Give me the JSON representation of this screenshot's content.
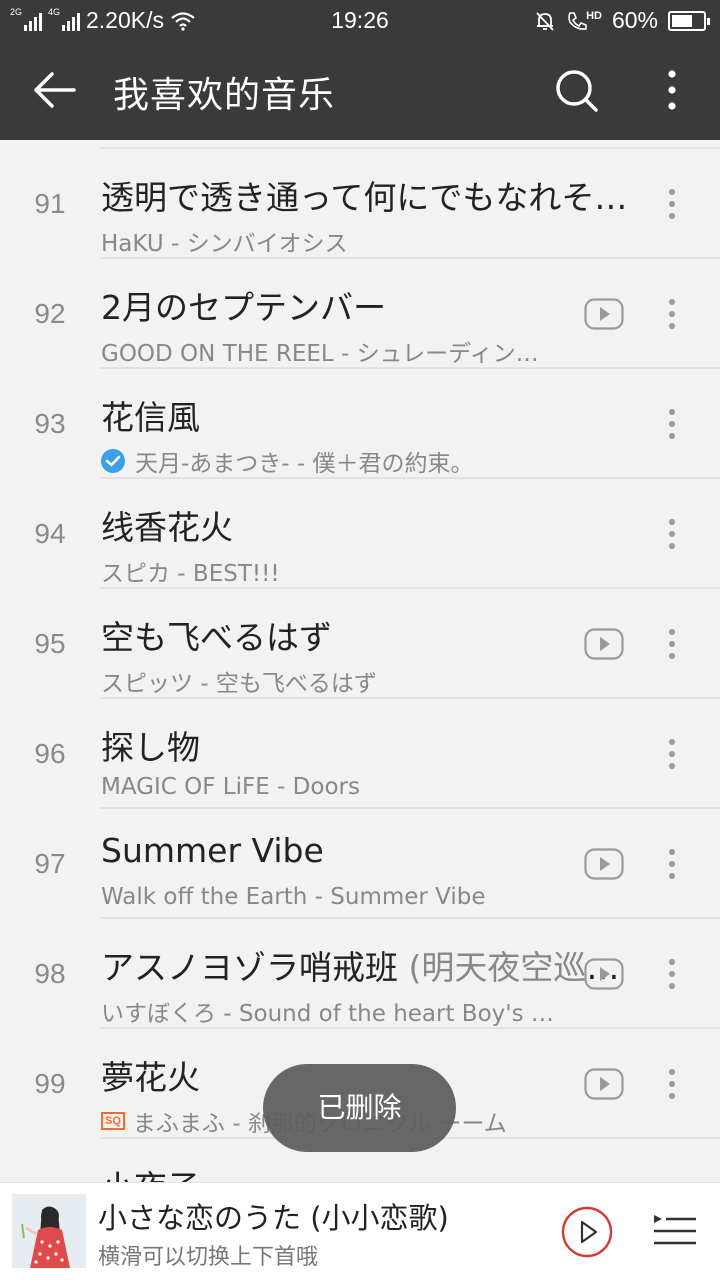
{
  "status_bar": {
    "sim1": "2G",
    "sim2": "4G",
    "speed": "2.20K/s",
    "time": "19:26",
    "battery": "60%",
    "hd_label": "HD"
  },
  "app_bar": {
    "title": "我喜欢的音乐"
  },
  "songs": [
    {
      "index": "91",
      "title": "透明で透き通って何にでもなれそうで",
      "alias": "",
      "subtitle": "HaKU - シンバイオシス",
      "has_mv": false,
      "badge": ""
    },
    {
      "index": "92",
      "title": "2月のセプテンバー",
      "alias": "",
      "subtitle": "GOOD ON THE REEL - シュレーディンガーの猫",
      "has_mv": true,
      "badge": ""
    },
    {
      "index": "93",
      "title": "花信風",
      "alias": "",
      "subtitle": "天月-あまつき- - 僕＋君の約束。",
      "has_mv": false,
      "badge": "check"
    },
    {
      "index": "94",
      "title": "线香花火",
      "alias": "",
      "subtitle": "スピカ - BEST!!!",
      "has_mv": false,
      "badge": ""
    },
    {
      "index": "95",
      "title": "空も飞べるはず",
      "alias": "",
      "subtitle": "スピッツ - 空も飞べるはず",
      "has_mv": true,
      "badge": ""
    },
    {
      "index": "96",
      "title": "探し物",
      "alias": "",
      "subtitle": "MAGIC OF LiFE - Doors",
      "has_mv": false,
      "badge": ""
    },
    {
      "index": "97",
      "title": "Summer Vibe",
      "alias": "",
      "subtitle": "Walk off the Earth - Summer Vibe",
      "has_mv": true,
      "badge": ""
    },
    {
      "index": "98",
      "title": "アスノヨゾラ哨戒班",
      "alias": "(明天夜空巡逻班)",
      "subtitle": "いすぼくろ - Sound of the heart  Boy's Side",
      "has_mv": true,
      "badge": ""
    },
    {
      "index": "99",
      "title": "夢花火",
      "alias": "",
      "subtitle": "まふまふ - 刹那的クロニクル ーーム",
      "has_mv": true,
      "badge": "SQ"
    },
    {
      "index": "",
      "title": "小夜子",
      "alias": "",
      "subtitle": "",
      "has_mv": false,
      "badge": ""
    }
  ],
  "toast": {
    "text": "已删除"
  },
  "player": {
    "title": "小さな恋のうた (小小恋歌)",
    "hint": "横滑可以切换上下首哦"
  },
  "colors": {
    "bar": "#3a3a3a",
    "background": "#f2f2f3",
    "accent_red": "#d33a31",
    "check_blue": "#3aa0e8",
    "sq_orange": "#ff6a2b"
  }
}
